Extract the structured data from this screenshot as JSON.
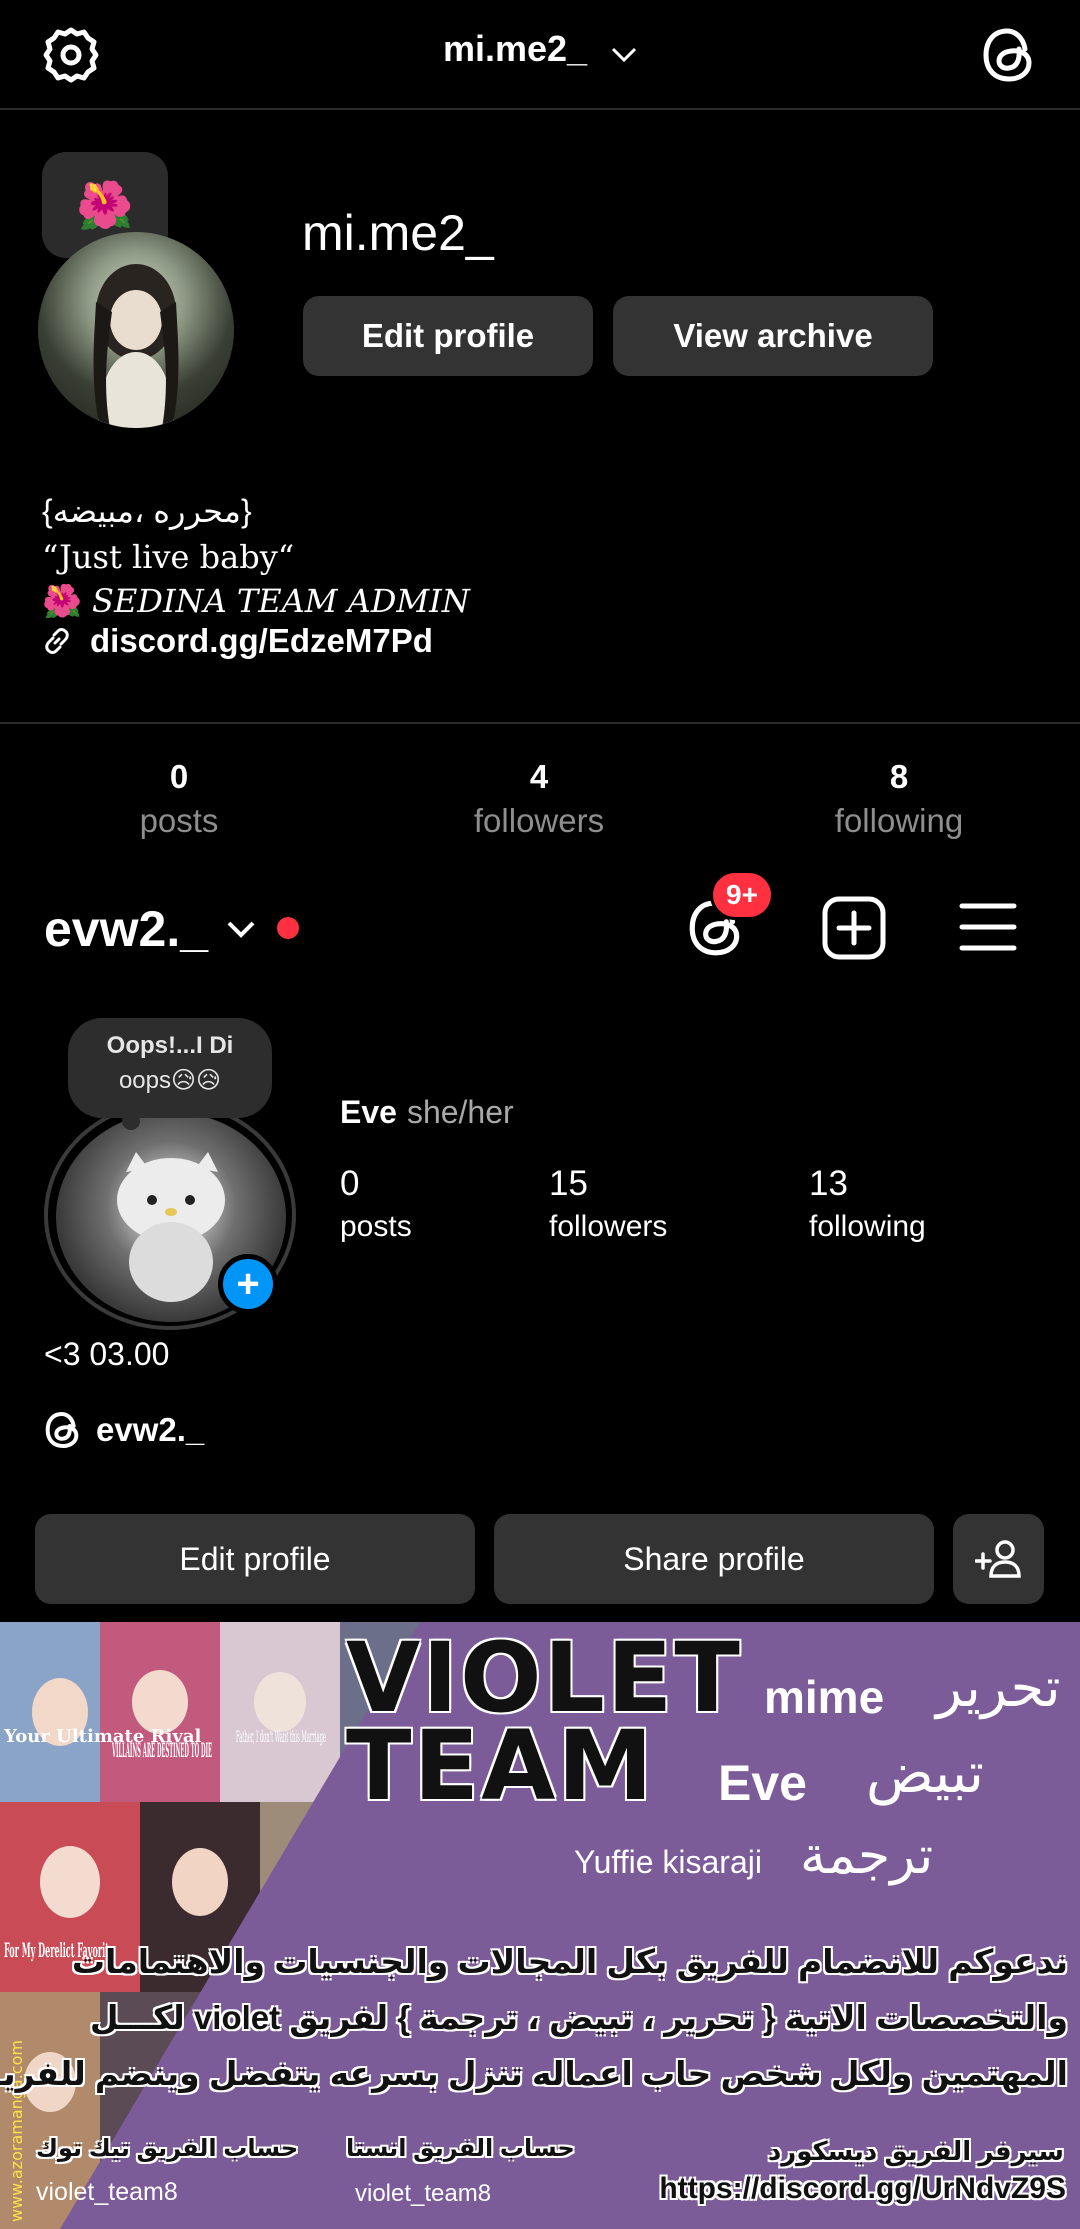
{
  "topbar": {
    "title": "mi.me2_"
  },
  "profile1": {
    "note_emoji": "🌺",
    "username": "mi.me2_",
    "edit_label": "Edit profile",
    "archive_label": "View archive",
    "bio": {
      "line1": "{محرره ،مبيضه}",
      "line2": "“Just live baby“",
      "line3": "🌺 𝑆𝐸𝐷𝐼𝑁𝐴 𝑇𝐸𝐴𝑀 𝐴𝐷𝑀𝐼𝑁",
      "link": "discord.gg/EdzeM7Pd"
    },
    "stats": [
      {
        "num": "0",
        "label": "posts"
      },
      {
        "num": "4",
        "label": "followers"
      },
      {
        "num": "8",
        "label": "following"
      }
    ]
  },
  "account2": {
    "username": "evw2._",
    "threads_badge": "9+"
  },
  "profile2": {
    "note_line1": "Oops!...I Di",
    "note_line2": "oops😥😥",
    "name": "Eve",
    "pronouns": "she/her",
    "stats": [
      {
        "num": "0",
        "label": "posts"
      },
      {
        "num": "15",
        "label": "followers"
      },
      {
        "num": "13",
        "label": "following"
      }
    ],
    "bio": "<3  03.00",
    "threads_handle": "evw2._",
    "edit_label": "Edit profile",
    "share_label": "Share profile"
  },
  "banner": {
    "title1": "VIOLET",
    "title2": "TEAM",
    "role1_name": "mime",
    "role1_ar": "تحرير",
    "role2_name": "Eve",
    "role2_ar": "تبيض",
    "role3_name": "Yuffie kisaraji",
    "role3_ar": "ترجمة",
    "para1": "ندعوكم للانضمام للفريق بكل المجالات والجنسيات والاهتمامات",
    "para2": "والتخصصات الاتية { تحرير ، تبيض ، ترجمة } لفريق violet لكـــل",
    "para3": "المهتمين ولكل شخص حاب اعماله تنزل بسرعه يتفضل وينضم للفريـــق",
    "tiktok_label": "حساب الفريق تيك توك",
    "tiktok_handle": "violet_team8",
    "insta_label": "حساب الفريق انستا",
    "insta_handle": "violet_team8",
    "discord_label": "سيرفر الفريق ديسكورد",
    "discord_url": "https://discord.gg/UrNdvZ9S",
    "watermark": "www.azoramanga.com",
    "cover1": "Your Ultimate Rival",
    "cover2": "VILLAINS ARE DESTINED TO DIE",
    "cover3": "Father, I don't Want this Marriage",
    "cover4": "For My Derelict Favorite"
  },
  "colors": {
    "accent_blue": "#0095f6",
    "badge_red": "#ff3040",
    "button_gray": "#333333",
    "banner_purple": "#7b5b98"
  }
}
